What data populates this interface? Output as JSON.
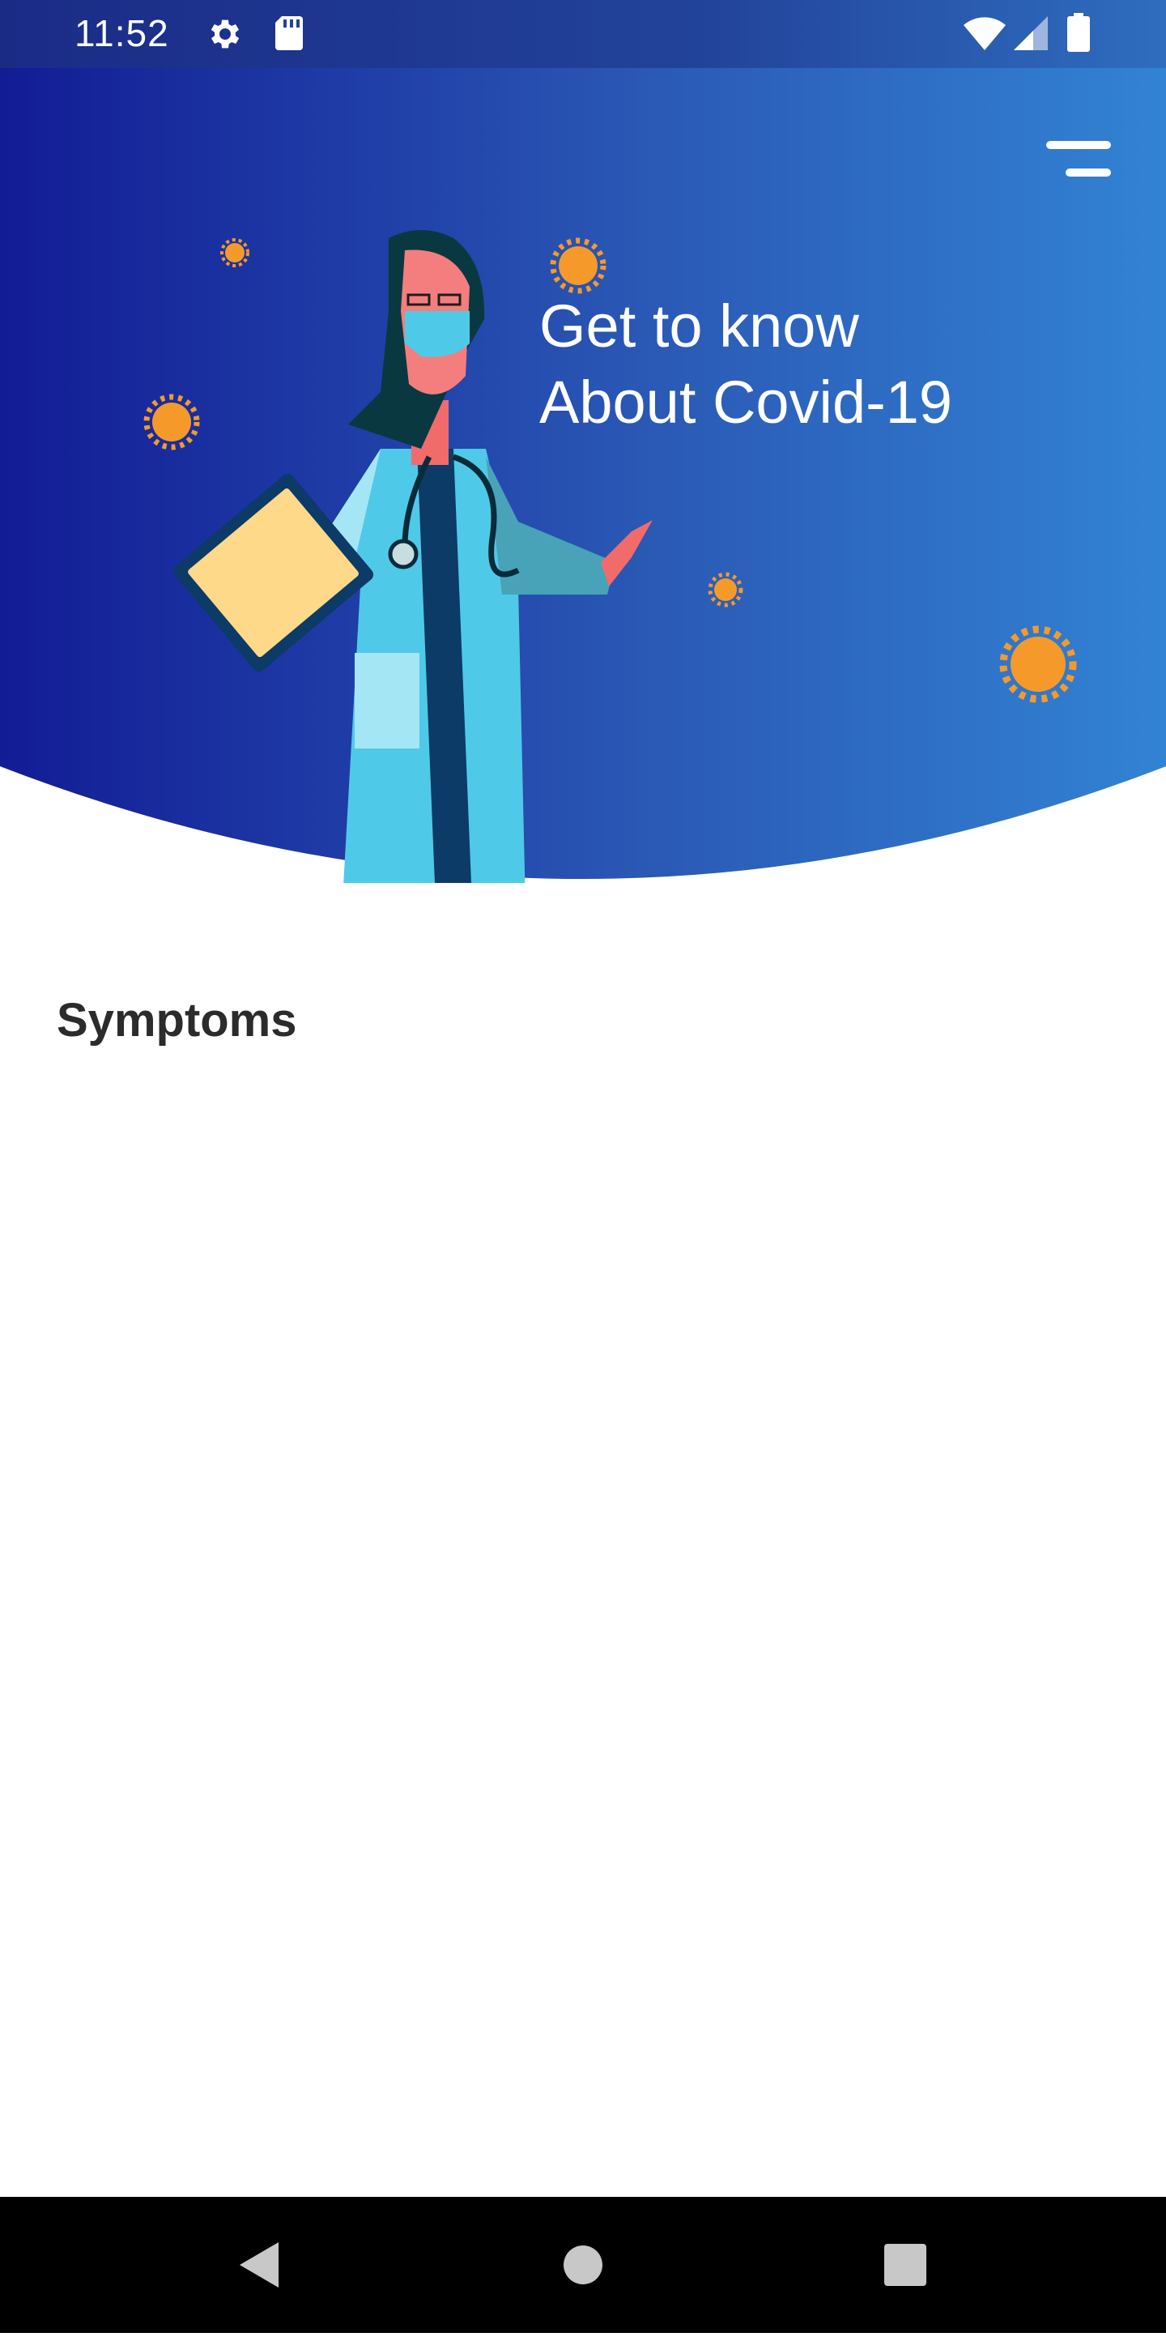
{
  "status_bar": {
    "time": "11:52",
    "icons": [
      "gear-icon",
      "sd-card-icon",
      "wifi-icon",
      "signal-icon",
      "battery-icon"
    ]
  },
  "header": {
    "headline_line1": "Get to know",
    "headline_line2": "About Covid-19",
    "gradient_start": "#121c95",
    "gradient_end": "#3283d3",
    "menu_icon": "menu-icon",
    "illustration": "doctor-illustration"
  },
  "main": {
    "section_title": "Symptoms"
  },
  "nav_bar": {
    "buttons": [
      "back-icon",
      "home-icon",
      "recents-icon"
    ]
  }
}
